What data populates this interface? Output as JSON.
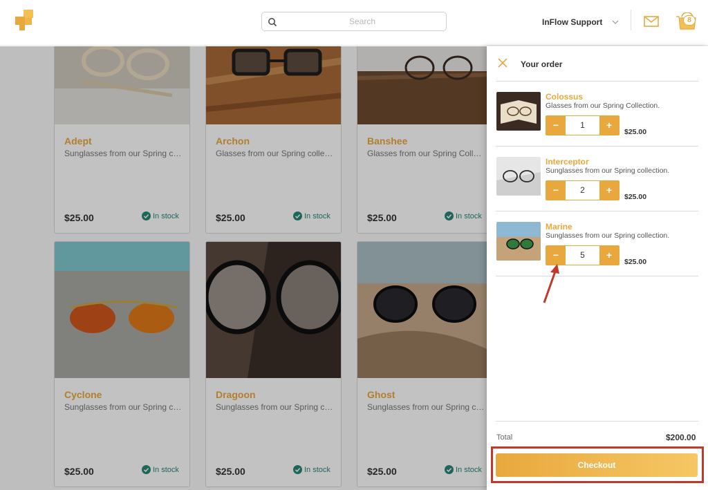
{
  "header": {
    "search_placeholder": "Search",
    "user_name": "InFlow Support",
    "cart_count": "8",
    "icons": [
      "logo-icon",
      "search-icon",
      "chevron-down-icon",
      "mail-icon",
      "cart-icon"
    ]
  },
  "colors": {
    "accent": "#e8a83e",
    "stock_green": "#2b8577",
    "annotation_red": "#c0392b"
  },
  "products": [
    {
      "title": "Adept",
      "desc": "Sunglasses from our Spring collection.",
      "price": "$25.00",
      "stock": "In stock"
    },
    {
      "title": "Archon",
      "desc": "Glasses from our Spring collection.",
      "price": "$25.00",
      "stock": "In stock"
    },
    {
      "title": "Banshee",
      "desc": "Glasses from our Spring Collection.",
      "price": "$25.00",
      "stock": "In stock"
    },
    {
      "title": "Cyclone",
      "desc": "Sunglasses from our Spring collection.",
      "price": "$25.00",
      "stock": "In stock"
    },
    {
      "title": "Dragoon",
      "desc": "Sunglasses from our Spring collection.",
      "price": "$25.00",
      "stock": "In stock"
    },
    {
      "title": "Ghost",
      "desc": "Sunglasses from our Spring collection.",
      "price": "$25.00",
      "stock": "In stock"
    }
  ],
  "order": {
    "title": "Your order",
    "items": [
      {
        "name": "Colossus",
        "desc": "Glasses from our Spring Collection.",
        "qty": "1",
        "price": "$25.00"
      },
      {
        "name": "Interceptor",
        "desc": "Sunglasses from our Spring collection.",
        "qty": "2",
        "price": "$25.00"
      },
      {
        "name": "Marine",
        "desc": "Sunglasses from our Spring collection.",
        "qty": "5",
        "price": "$25.00"
      }
    ],
    "minus_label": "−",
    "plus_label": "+",
    "total_label": "Total",
    "total_value": "$200.00",
    "checkout_label": "Checkout"
  }
}
